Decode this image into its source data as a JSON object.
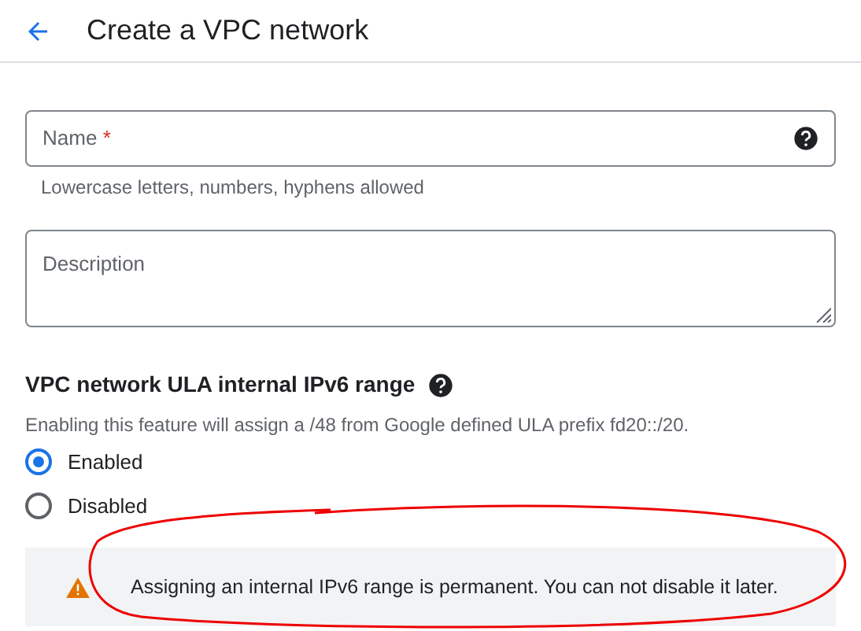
{
  "header": {
    "title": "Create a VPC network"
  },
  "name_field": {
    "label": "Name",
    "required_mark": "*",
    "hint": "Lowercase letters, numbers, hyphens allowed"
  },
  "description_field": {
    "label": "Description"
  },
  "ipv6_section": {
    "title": "VPC network ULA internal IPv6 range",
    "description": "Enabling this feature will assign a /48 from Google defined ULA prefix fd20::/20.",
    "options": [
      {
        "label": "Enabled",
        "selected": true
      },
      {
        "label": "Disabled",
        "selected": false
      }
    ],
    "alert": {
      "text": "Assigning an internal IPv6 range is permanent. You can not disable it later."
    }
  }
}
